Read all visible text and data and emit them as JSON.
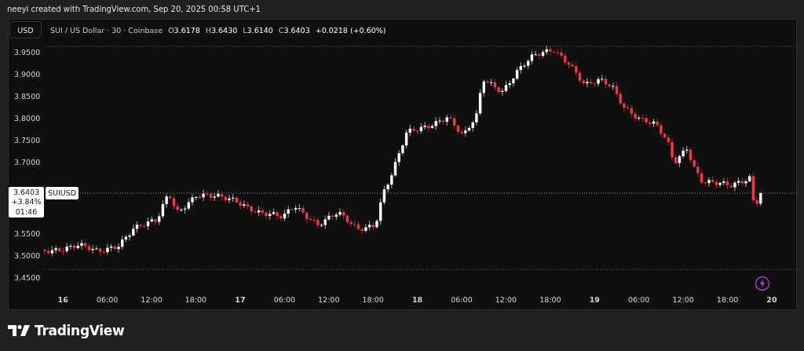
{
  "header": {
    "text": "neeyi created with TradingView.com, Sep 20, 2025 00:58 UTC+1"
  },
  "toolbar": {
    "currency_button": "USD",
    "symbol": "SUI / US Dollar · 30 · Coinbase",
    "ohlc": [
      {
        "label": "O",
        "value": "3.6178"
      },
      {
        "label": "H",
        "value": "3.6430"
      },
      {
        "label": "L",
        "value": "3.6140"
      },
      {
        "label": "C",
        "value": "3.6403"
      }
    ],
    "change": "+0.0218 (+0.60%)"
  },
  "price_axis": {
    "upper_ticks": [
      "3.9500",
      "3.9000",
      "3.8500",
      "3.8000",
      "3.7500",
      "3.7000"
    ],
    "lower_ticks": [
      "3.5500",
      "3.5000",
      "3.4500"
    ]
  },
  "price_tag": {
    "price": "3.6403",
    "change": "+3.84%",
    "countdown": "01:46",
    "symbol": "SUIUSD"
  },
  "time_axis": {
    "ticks": [
      {
        "label": "16",
        "kind": "day"
      },
      {
        "label": "06:00",
        "kind": "time"
      },
      {
        "label": "12:00",
        "kind": "time"
      },
      {
        "label": "18:00",
        "kind": "time"
      },
      {
        "label": "17",
        "kind": "day"
      },
      {
        "label": "06:00",
        "kind": "time"
      },
      {
        "label": "12:00",
        "kind": "time"
      },
      {
        "label": "18:00",
        "kind": "time"
      },
      {
        "label": "18",
        "kind": "day"
      },
      {
        "label": "06:00",
        "kind": "time"
      },
      {
        "label": "12:00",
        "kind": "time"
      },
      {
        "label": "18:00",
        "kind": "time"
      },
      {
        "label": "19",
        "kind": "day"
      },
      {
        "label": "06:00",
        "kind": "time"
      },
      {
        "label": "12:00",
        "kind": "time"
      },
      {
        "label": "18:00",
        "kind": "time"
      },
      {
        "label": "20",
        "kind": "day"
      }
    ]
  },
  "footer": {
    "logo": "TradingView"
  }
}
